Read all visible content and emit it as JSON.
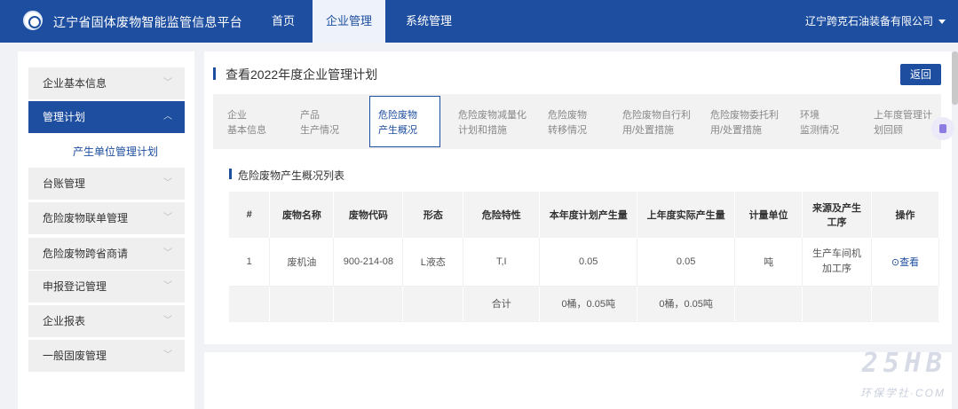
{
  "header": {
    "app_title": "辽宁省固体废物智能监管信息平台",
    "nav": [
      "首页",
      "企业管理",
      "系统管理"
    ],
    "active_nav": "企业管理",
    "company": "辽宁跨克石油装备有限公司"
  },
  "sidebar": {
    "items": [
      {
        "label": "企业基本信息"
      },
      {
        "label": "管理计划",
        "active": true
      },
      {
        "label": "台账管理"
      },
      {
        "label": "危险废物联单管理"
      },
      {
        "label": "危险废物跨省商请"
      },
      {
        "label": "申报登记管理"
      },
      {
        "label": "企业报表"
      },
      {
        "label": "一般固废管理"
      }
    ],
    "sub_item": "产生单位管理计划"
  },
  "main": {
    "page_title": "查看2022年度企业管理计划",
    "back_button": "返回",
    "tabs": [
      {
        "line1": "企业",
        "line2": "基本信息"
      },
      {
        "line1": "产品",
        "line2": "生产情况"
      },
      {
        "line1": "危险废物",
        "line2": "产生概况",
        "active": true
      },
      {
        "line1": "危险废物减量化",
        "line2": "计划和措施"
      },
      {
        "line1": "危险废物",
        "line2": "转移情况"
      },
      {
        "line1": "危险废物自行利",
        "line2": "用/处置措施"
      },
      {
        "line1": "危险废物委托利",
        "line2": "用/处置措施"
      },
      {
        "line1": "环境",
        "line2": "监测情况"
      },
      {
        "line1": "上年度管理计",
        "line2": "划回顾"
      }
    ],
    "section_title": "危险废物产生概况列表",
    "table": {
      "headers": [
        "#",
        "废物名称",
        "废物代码",
        "形态",
        "危险特性",
        "本年度计划产生量",
        "上年度实际产生量",
        "计量单位",
        "来源及产生工序",
        "操作"
      ],
      "rows": [
        [
          "1",
          "废机油",
          "900-214-08",
          "L液态",
          "T,I",
          "0.05",
          "0.05",
          "吨",
          "生产车间机加工序",
          "查看"
        ]
      ],
      "total": {
        "label": "合计",
        "plan": "0桶，0.05吨",
        "actual": "0桶，0.05吨"
      }
    }
  },
  "watermark": {
    "big": "25HB",
    "small": "环保学社·COM"
  }
}
